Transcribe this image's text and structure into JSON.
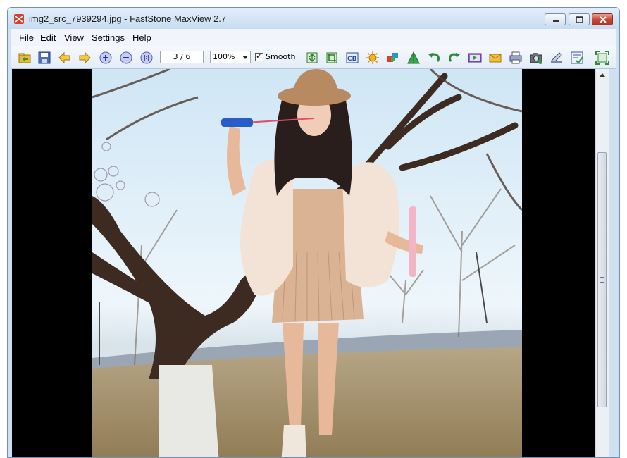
{
  "window": {
    "title": "img2_src_7939294.jpg - FastStone MaxView 2.7"
  },
  "menu": {
    "items": [
      "File",
      "Edit",
      "View",
      "Settings",
      "Help"
    ]
  },
  "toolbar": {
    "page_indicator": "3 / 6",
    "zoom_value": "100%",
    "smooth_label": "Smooth",
    "smooth_checked": true,
    "icons": [
      "open-folder-icon",
      "save-icon",
      "previous-arrow-icon",
      "next-arrow-icon",
      "zoom-in-icon",
      "zoom-out-icon",
      "actual-size-icon",
      "resize-icon",
      "crop-icon",
      "color-balance-icon",
      "brightness-icon",
      "adjust-colors-icon",
      "sharpen-icon",
      "rotate-left-icon",
      "rotate-right-icon",
      "slideshow-icon",
      "email-icon",
      "print-icon",
      "camera-capture-icon",
      "scanner-icon",
      "properties-icon",
      "fullscreen-icon"
    ]
  },
  "colors": {
    "title_bar": "#c7dbf1",
    "close_button": "#c74b36",
    "viewer_background": "#000000"
  },
  "image": {
    "description": ""
  }
}
